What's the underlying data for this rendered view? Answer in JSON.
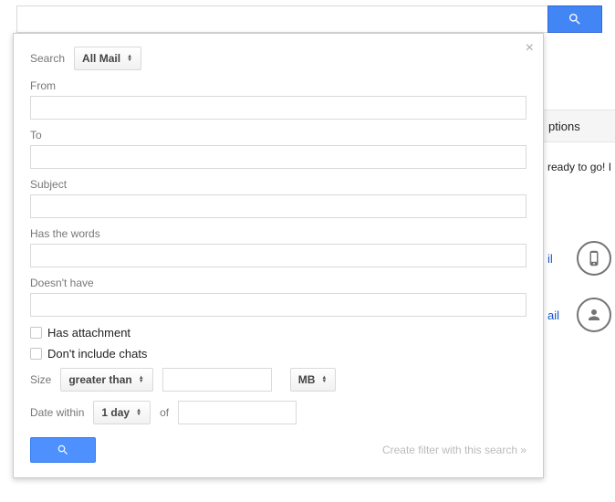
{
  "topbar": {
    "search_value": ""
  },
  "bg": {
    "stripe": "ptions",
    "snippet": "ready to go! I",
    "link1": "il",
    "link2": "ail"
  },
  "panel": {
    "search_label": "Search",
    "search_scope": "All Mail",
    "from_label": "From",
    "from_value": "",
    "to_label": "To",
    "to_value": "",
    "subject_label": "Subject",
    "subject_value": "",
    "haswords_label": "Has the words",
    "haswords_value": "",
    "doesnthave_label": "Doesn't have",
    "doesnthave_value": "",
    "has_attachment_label": "Has attachment",
    "dont_include_chats_label": "Don't include chats",
    "size_label": "Size",
    "size_op": "greater than",
    "size_value": "",
    "size_unit": "MB",
    "datewithin_label": "Date within",
    "datewithin_value": "1 day",
    "of_label": "of",
    "date_value": "",
    "filter_link": "Create filter with this search »"
  }
}
